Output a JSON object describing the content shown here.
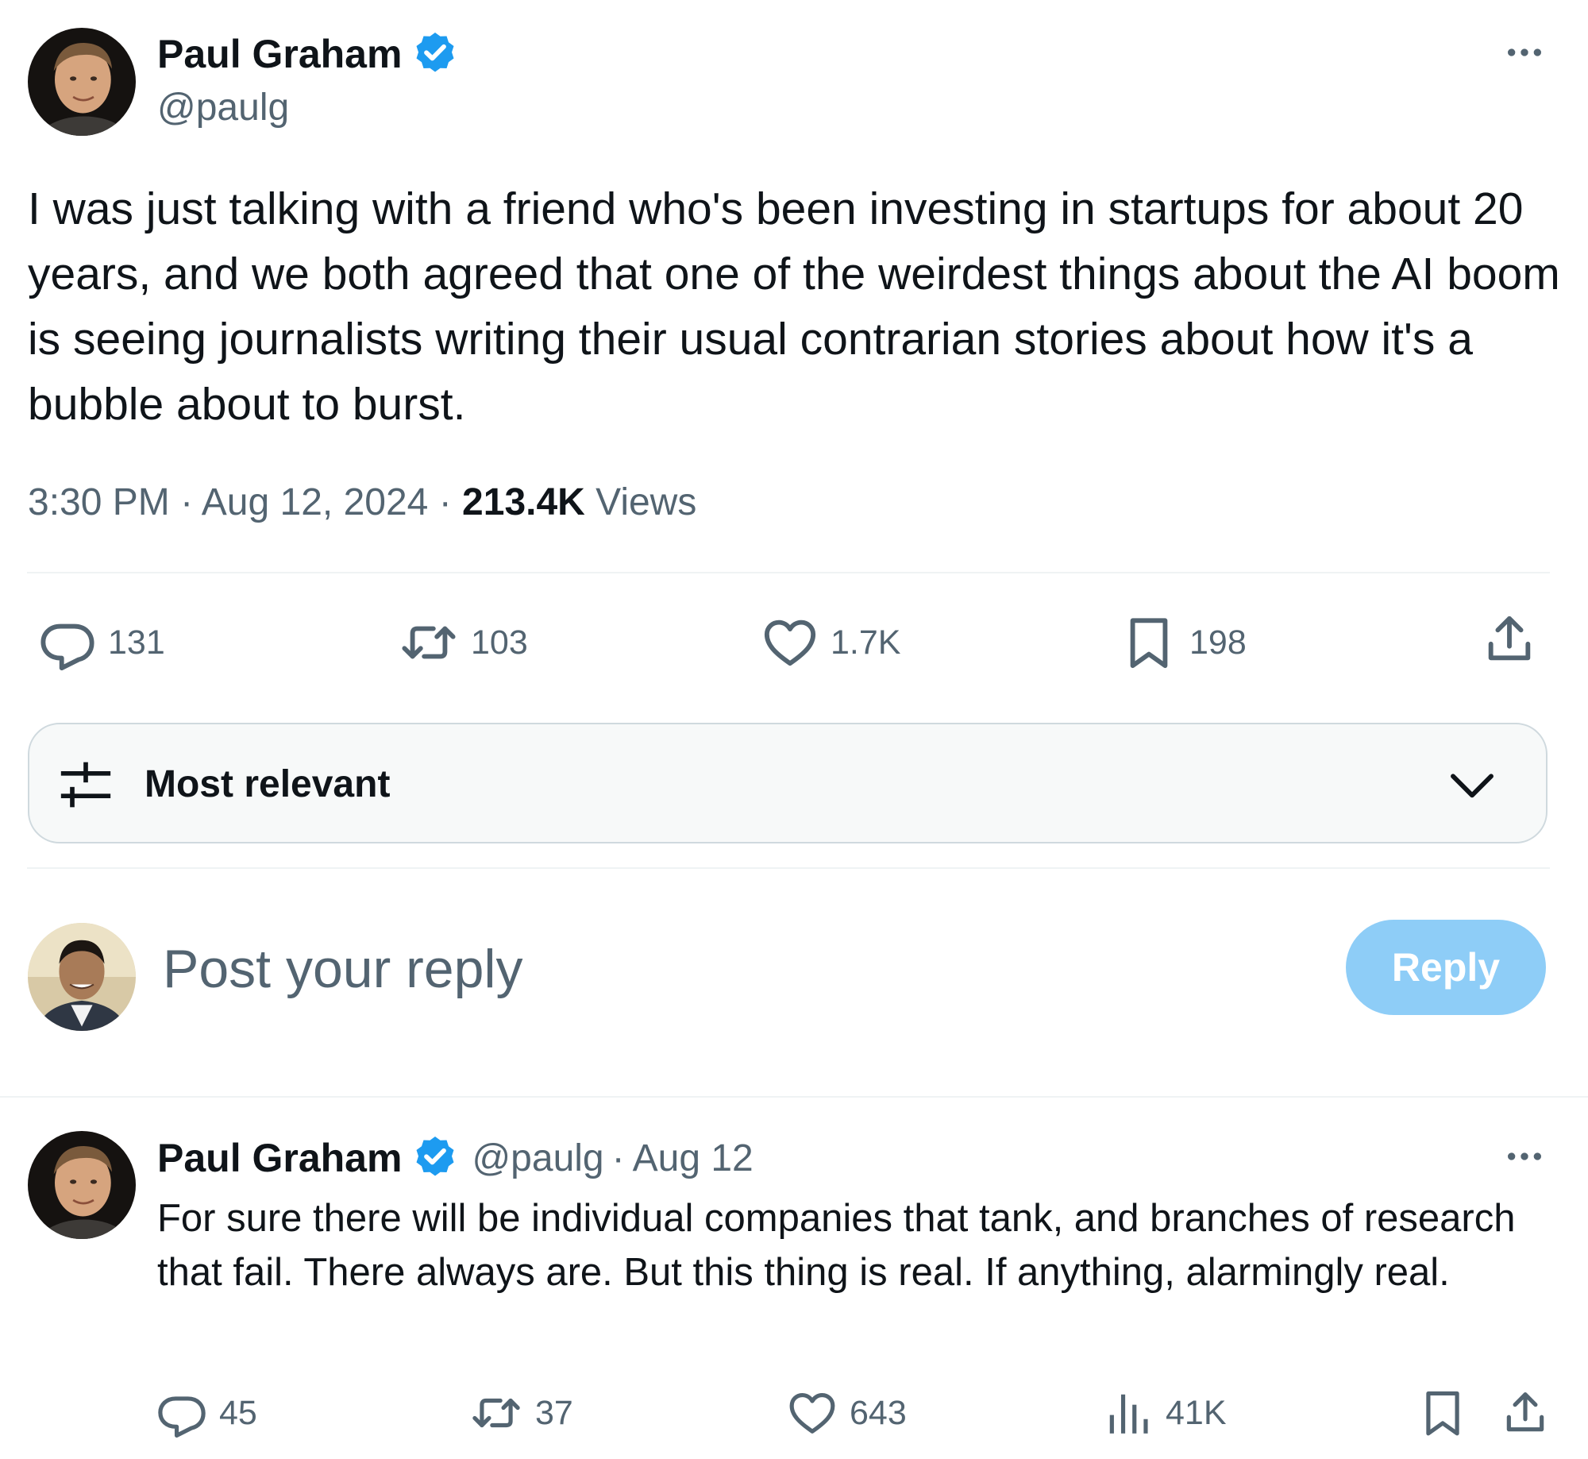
{
  "post": {
    "author_name": "Paul Graham",
    "handle": "@paulg",
    "text": "I was just talking with a friend who's been investing in startups for about 20 years, and we both agreed that one of the weirdest things about the AI boom is seeing journalists writing their usual contrarian stories about how it's a bubble about to burst.",
    "time": "3:30 PM",
    "date": "Aug 12, 2024",
    "views_count": "213.4K",
    "views_label": "Views",
    "separator": "·",
    "stats": {
      "replies": "131",
      "reposts": "103",
      "likes": "1.7K",
      "bookmarks": "198"
    }
  },
  "sort": {
    "label": "Most relevant"
  },
  "compose": {
    "placeholder": "Post your reply",
    "button_label": "Reply"
  },
  "reply": {
    "author_name": "Paul Graham",
    "handle": "@paulg",
    "separator": "·",
    "date": "Aug 12",
    "text": "For sure there will be individual companies that tank, and branches of research that fail. There always are. But this thing is real. If anything, alarmingly real.",
    "stats": {
      "replies": "45",
      "reposts": "37",
      "likes": "643",
      "views": "41K"
    }
  },
  "colors": {
    "verified": "#1d9bf0",
    "reply_button": "#8ecdf7",
    "secondary_text": "#536471",
    "border": "#cfd9de"
  },
  "icons": [
    "more-icon",
    "verified-badge-icon",
    "reply-icon",
    "repost-icon",
    "like-icon",
    "bookmark-icon",
    "share-icon",
    "sort-sliders-icon",
    "chevron-down-icon",
    "views-icon"
  ]
}
